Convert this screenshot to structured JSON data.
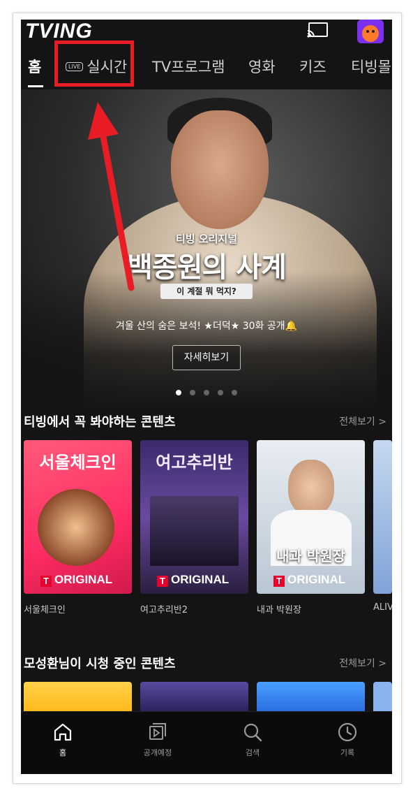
{
  "app": {
    "logo": "TVING"
  },
  "header": {
    "tabs": [
      {
        "label": "홈",
        "active": true
      },
      {
        "label": "실시간",
        "badge": "LIVE"
      },
      {
        "label": "TV프로그램"
      },
      {
        "label": "영화"
      },
      {
        "label": "키즈"
      },
      {
        "label": "티빙몰"
      }
    ]
  },
  "hero": {
    "subtitle": "티빙 오리지널",
    "title": "백종원의 사계",
    "tagline": "이 계절 뭐 먹지?",
    "description": "겨울 산의 숨은 보석! ★더덕★ 30화 공개🔔",
    "button": "자세히보기",
    "pages": 5,
    "current_page": 1
  },
  "section1": {
    "title": "티빙에서 꼭 봐야하는 콘텐츠",
    "more": "전체보기 >",
    "items": [
      {
        "poster_title": "서울체크인",
        "badge": "ORIGINAL",
        "caption": "서울체크인",
        "color": "#ff3b6b"
      },
      {
        "poster_title": "여고추리반",
        "badge": "ORIGINAL",
        "caption": "여고추리반2",
        "color": "#5b3d9b"
      },
      {
        "poster_title": "내과 박원장",
        "badge": "ORIGINAL",
        "caption": "내과 박원장",
        "color": "#cfd8e3"
      },
      {
        "poster_title": "",
        "badge": "",
        "caption": "ALIV",
        "color": "#9fc0e8"
      }
    ]
  },
  "section2": {
    "title": "모성환님이 시청 중인 콘텐츠",
    "more": "전체보기 >"
  },
  "bottom_nav": {
    "items": [
      {
        "label": "홈",
        "icon": "home-icon",
        "active": true
      },
      {
        "label": "공개예정",
        "icon": "play-icon"
      },
      {
        "label": "검색",
        "icon": "search-icon"
      },
      {
        "label": "기록",
        "icon": "clock-icon"
      }
    ]
  },
  "colors": {
    "background": "#141414",
    "accent_red": "#e6002d",
    "annotation_red": "#e81c24"
  }
}
